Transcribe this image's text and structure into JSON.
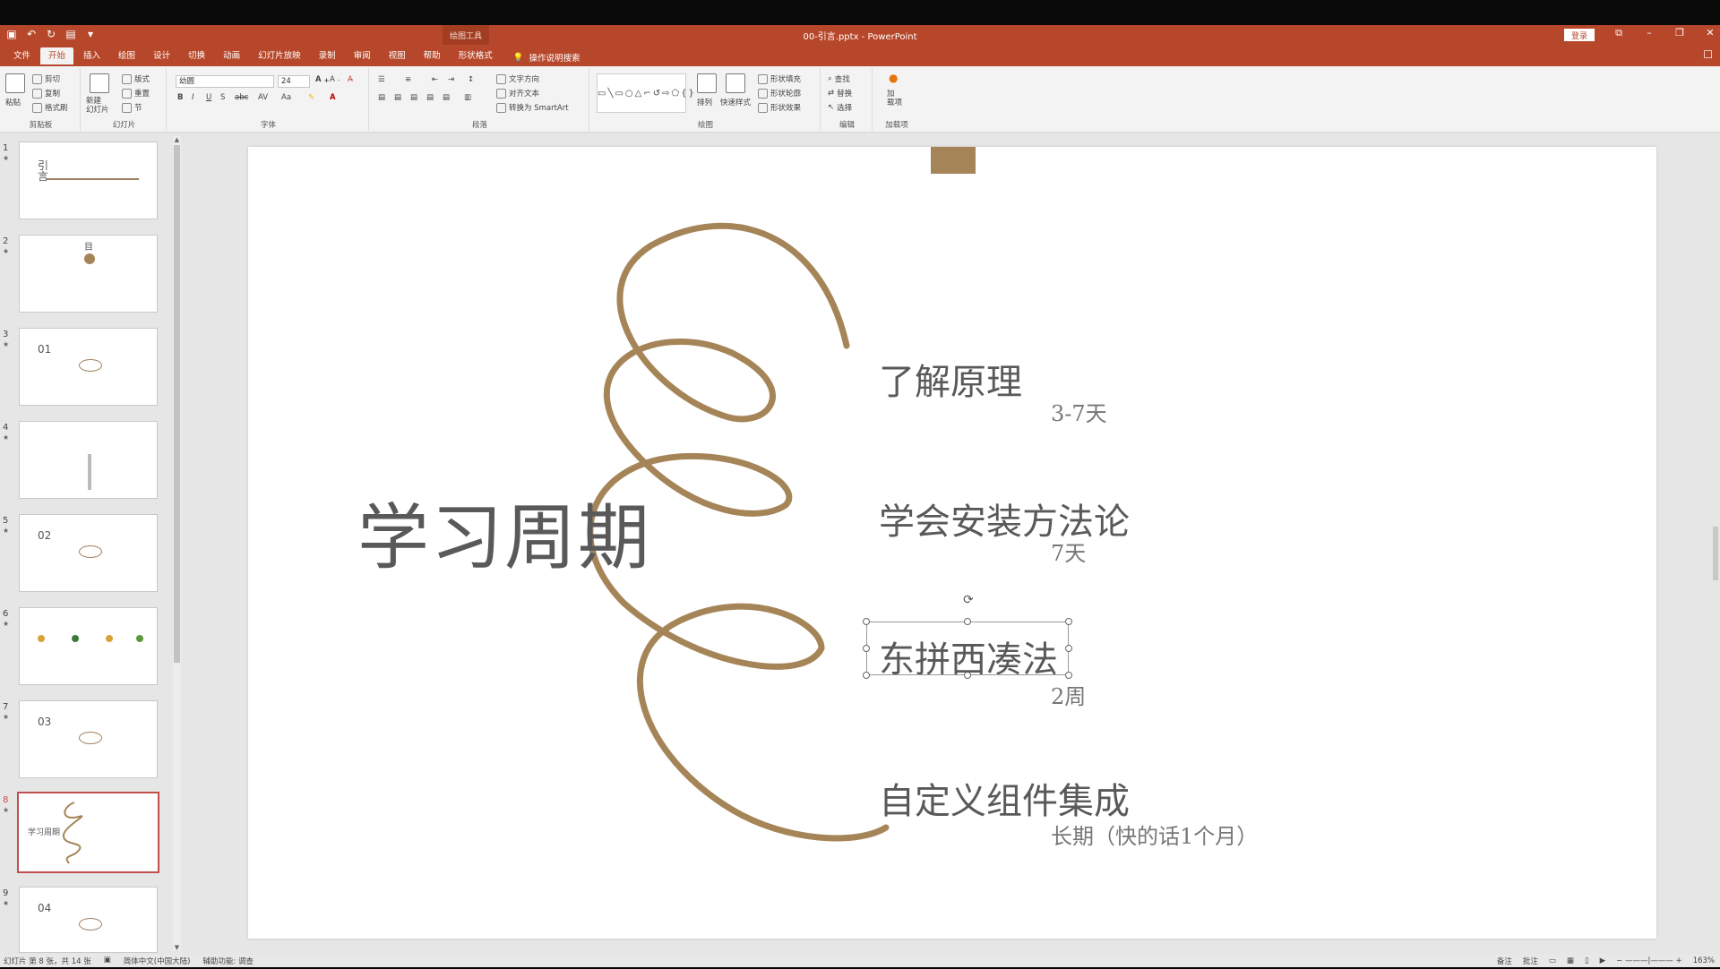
{
  "window": {
    "doc_title": "00-引言.pptx - PowerPoint",
    "context_tool_title": "绘图工具",
    "login_label": "登录",
    "controls": [
      "restore-ribbon",
      "minimize",
      "maximize",
      "close"
    ]
  },
  "tabs": [
    {
      "label": "文件",
      "active": false
    },
    {
      "label": "开始",
      "active": true
    },
    {
      "label": "插入",
      "active": false
    },
    {
      "label": "绘图",
      "active": false
    },
    {
      "label": "设计",
      "active": false
    },
    {
      "label": "切换",
      "active": false
    },
    {
      "label": "动画",
      "active": false
    },
    {
      "label": "幻灯片放映",
      "active": false
    },
    {
      "label": "录制",
      "active": false
    },
    {
      "label": "审阅",
      "active": false
    },
    {
      "label": "视图",
      "active": false
    },
    {
      "label": "帮助",
      "active": false
    },
    {
      "label": "形状格式",
      "active": false
    }
  ],
  "tell_me": "操作说明搜索",
  "ribbon": {
    "clipboard": {
      "label": "剪贴板",
      "paste": "粘贴",
      "cut": "剪切",
      "copy": "复制",
      "format_painter": "格式刷"
    },
    "slides": {
      "label": "幻灯片",
      "new_slide": "新建\n幻灯片",
      "layout": "版式",
      "reset": "重置",
      "section": "节"
    },
    "font": {
      "label": "字体",
      "font_name": "幼圆",
      "font_size": "24"
    },
    "paragraph": {
      "label": "段落",
      "text_direction": "文字方向",
      "align_text": "对齐文本",
      "convert_smartart": "转换为 SmartArt"
    },
    "drawing": {
      "label": "绘图",
      "arrange": "排列",
      "quick_styles": "快速样式",
      "shape_fill": "形状填充",
      "shape_outline": "形状轮廓",
      "shape_effects": "形状效果"
    },
    "editing": {
      "label": "编辑",
      "find": "查找",
      "replace": "替换",
      "select": "选择"
    },
    "addins": {
      "label": "加载项",
      "addins_btn": "加\n载项"
    }
  },
  "thumbnails": [
    {
      "num": "1",
      "label": "引\n言"
    },
    {
      "num": "2",
      "label": "目"
    },
    {
      "num": "3",
      "label": "01"
    },
    {
      "num": "4",
      "label": ""
    },
    {
      "num": "5",
      "label": "02"
    },
    {
      "num": "6",
      "label": ""
    },
    {
      "num": "7",
      "label": "03"
    },
    {
      "num": "8",
      "label": "学习周期",
      "active": true
    },
    {
      "num": "9",
      "label": "04"
    }
  ],
  "slide": {
    "title": "学习周期",
    "steps": [
      {
        "title": "了解原理",
        "sub": "3-7天"
      },
      {
        "title": "学会安装方法论",
        "sub": "7天"
      },
      {
        "title": "东拼西凑法",
        "sub": "2周"
      },
      {
        "title": "自定义组件集成",
        "sub": "长期（快的话1个月）"
      }
    ],
    "accent_color": "#a58558"
  },
  "status": {
    "slide_info": "幻灯片 第 8 张，共 14 张",
    "language": "简体中文(中国大陆)",
    "accessibility": "辅助功能: 调查",
    "notes": "备注",
    "comments": "批注",
    "zoom": "163%"
  }
}
